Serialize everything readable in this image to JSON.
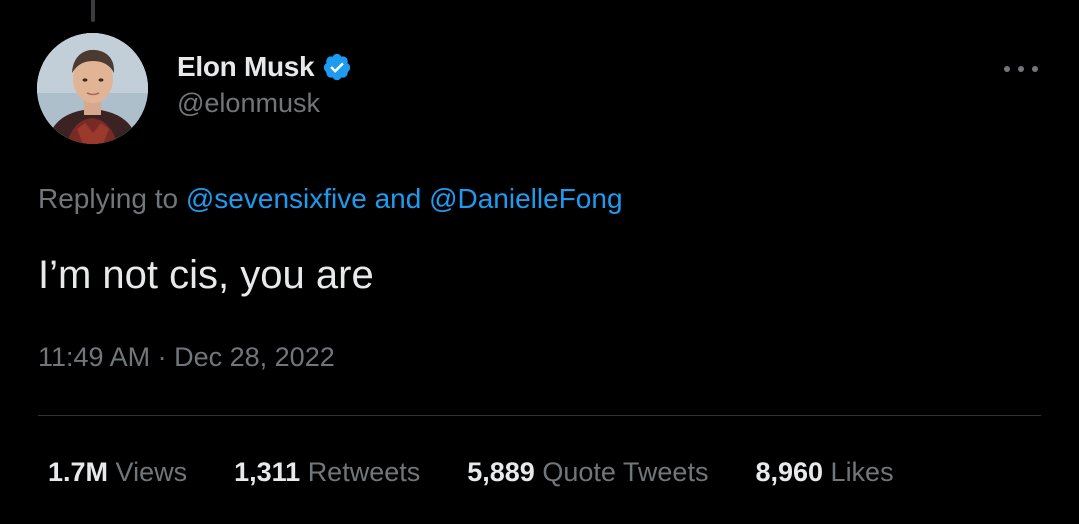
{
  "author": {
    "display_name": "Elon Musk",
    "handle": "@elonmusk",
    "verified": true,
    "verified_color": "#1d9bf0"
  },
  "reply": {
    "prefix": "Replying to",
    "mention_1": "@sevensixfive",
    "conjunction": "and",
    "mention_2": "@DanielleFong"
  },
  "tweet": {
    "text": "I’m not cis, you are",
    "time": "11:49 AM",
    "separator": "·",
    "date": "Dec 28, 2022"
  },
  "stats": [
    {
      "value": "1.7M",
      "label": "Views"
    },
    {
      "value": "1,311",
      "label": "Retweets"
    },
    {
      "value": "5,889",
      "label": "Quote Tweets"
    },
    {
      "value": "8,960",
      "label": "Likes"
    }
  ],
  "icons": {
    "more": "more-options-icon",
    "verified": "verified-badge-icon"
  },
  "colors": {
    "background": "#000000",
    "text": "#e7e9ea",
    "secondary": "#71767b",
    "link": "#1d9bf0",
    "divider": "#2f3336"
  }
}
